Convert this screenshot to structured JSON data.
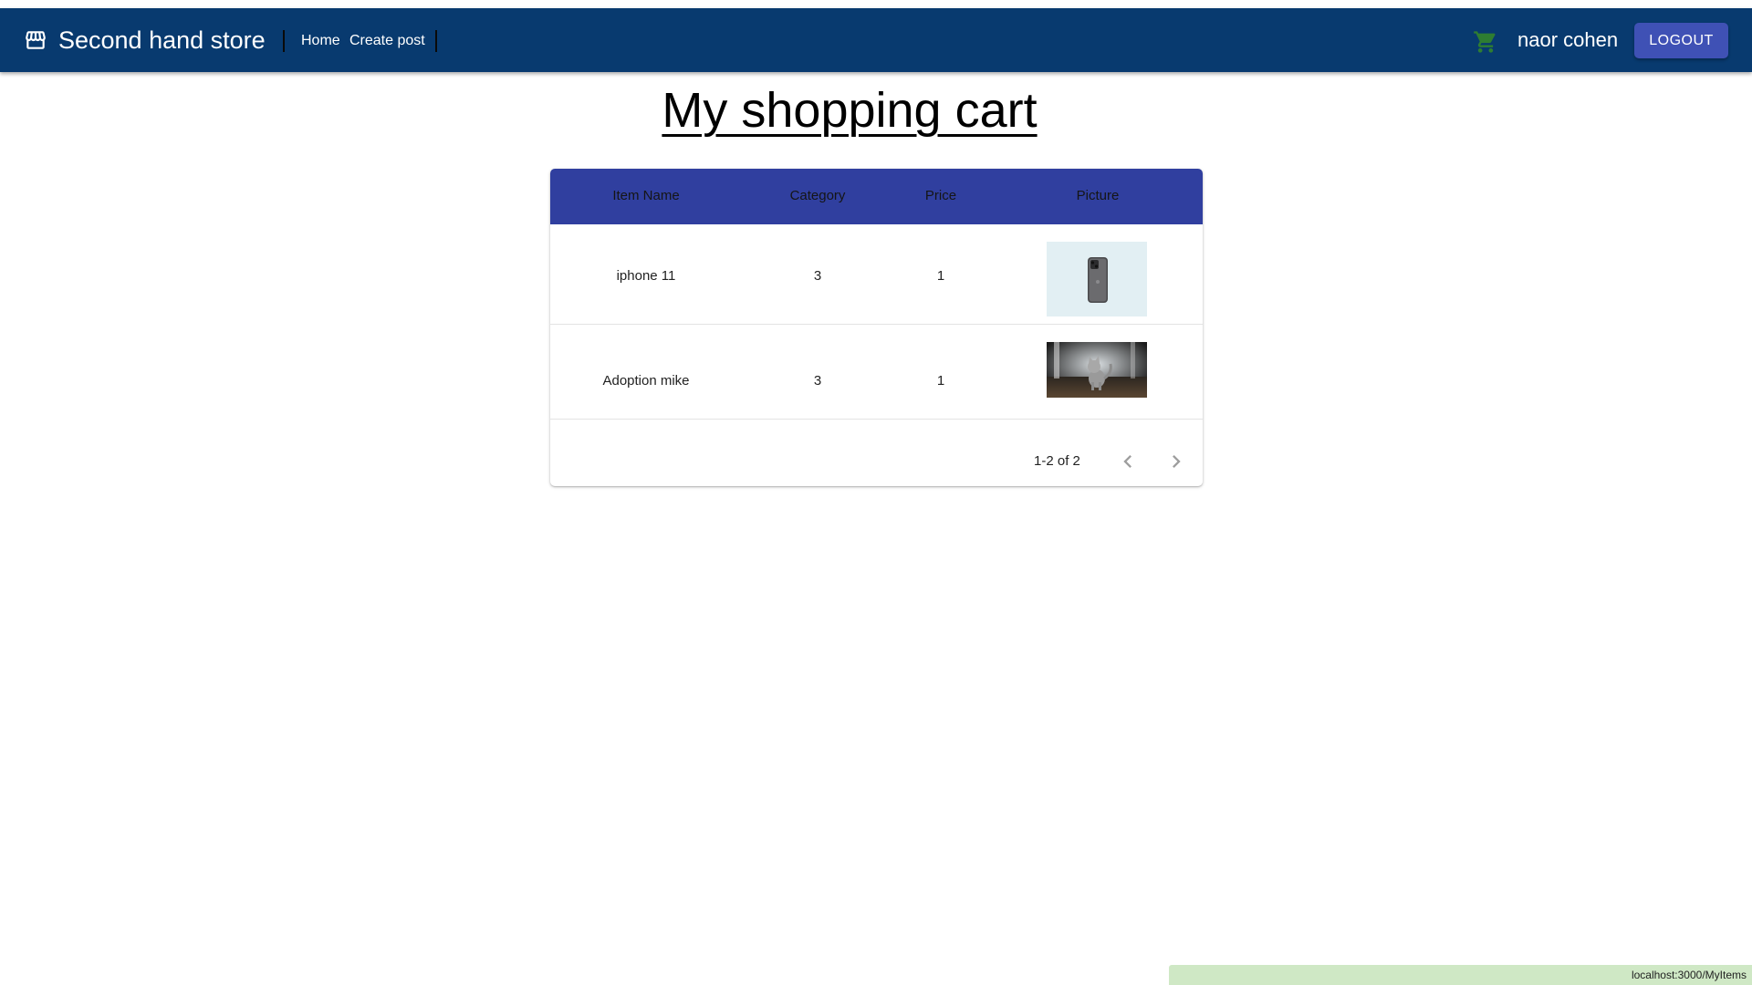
{
  "app": {
    "brand_title": "Second hand store",
    "nav": {
      "home": "Home",
      "create_post": "Create post"
    },
    "user_name": "naor cohen",
    "logout_label": "LOGOUT"
  },
  "page": {
    "title": "My shopping cart"
  },
  "table": {
    "columns": [
      "Item Name",
      "Category",
      "Price",
      "Picture"
    ],
    "rows": [
      {
        "name": "iphone 11",
        "category": "3",
        "price": "1",
        "picture": "phone-image"
      },
      {
        "name": "Adoption mike",
        "category": "3",
        "price": "1",
        "picture": "cat-image"
      }
    ],
    "pagination": "1-2 of 2"
  },
  "status_bar": {
    "url": "localhost:3000/MyItems"
  },
  "colors": {
    "appbar": "#083a6f",
    "table_header": "#303f9f",
    "logout_button": "#3f51b5",
    "cart_icon": "#2e7d32",
    "status_bar": "#cfe8c5"
  }
}
